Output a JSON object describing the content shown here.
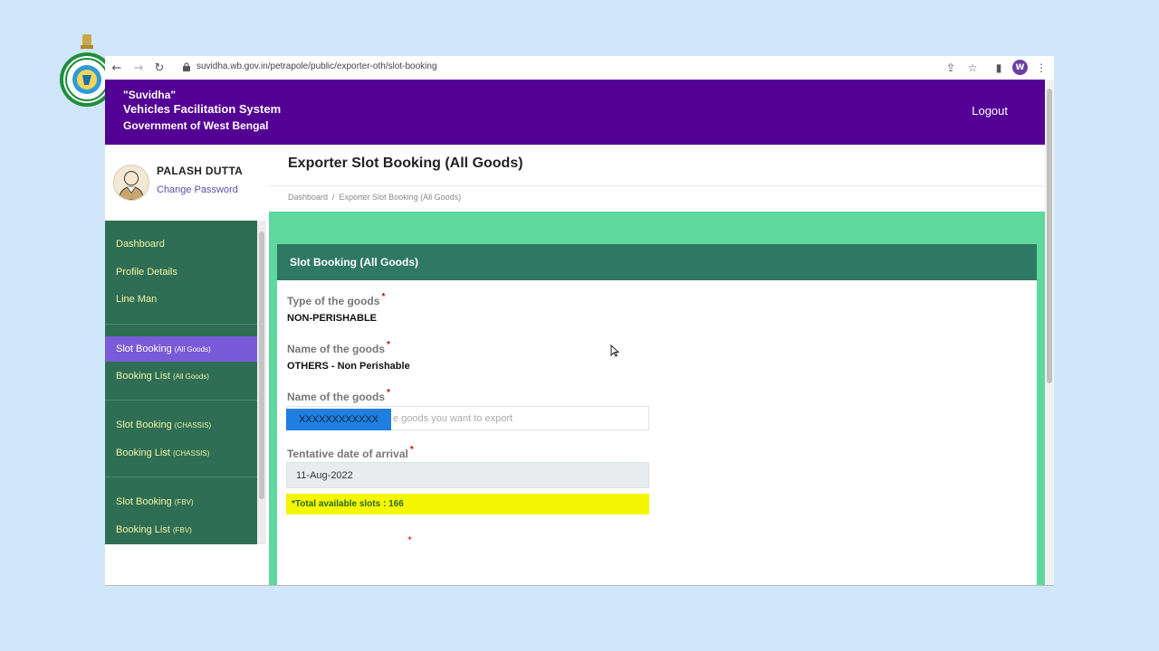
{
  "browser": {
    "url": "suvidha.wb.gov.in/petrapole/public/exporter-oth/slot-booking",
    "profile_initial": "W"
  },
  "header": {
    "title_line1": "\"Suvidha\"",
    "title_line2": "Vehicles Facilitation System",
    "title_line3": "Government of West Bengal",
    "logout_label": "Logout"
  },
  "user": {
    "name": "PALASH DUTTA",
    "change_password_label": "Change Password"
  },
  "sidebar": {
    "items": [
      {
        "label": "Dashboard",
        "tag": ""
      },
      {
        "label": "Profile Details",
        "tag": ""
      },
      {
        "label": "Line Man",
        "tag": ""
      },
      {
        "label": "Slot Booking",
        "tag": "(All Goods)"
      },
      {
        "label": "Booking List",
        "tag": "(All Goods)"
      },
      {
        "label": "Slot Booking",
        "tag": "(CHASSIS)"
      },
      {
        "label": "Booking List",
        "tag": "(CHASSIS)"
      },
      {
        "label": "Slot Booking",
        "tag": "(FBV)"
      },
      {
        "label": "Booking List",
        "tag": "(FBV)"
      }
    ],
    "active_index": 3
  },
  "page": {
    "title": "Exporter Slot Booking (All Goods)",
    "breadcrumb": [
      "Dashboard",
      "Exporter Slot Booking (All Goods)"
    ],
    "breadcrumb_separator": "/"
  },
  "form": {
    "header": "Slot Booking (All Goods)",
    "required_mark": "*",
    "type_label": "Type of the goods",
    "type_value": "NON-PERISHABLE",
    "name_label": "Name of the goods",
    "name_value": "OTHERS - Non Perishable",
    "goods_input_label": "Name of the goods",
    "goods_input_placeholder": "e goods you want to export",
    "goods_input_redacted": "XXXXXXXXXXXX",
    "arrival_label": "Tentative date of arrival",
    "arrival_value": "11-Aug-2022",
    "slots_text": "*Total available slots : 166"
  },
  "colors": {
    "header_purple": "#530094",
    "sidebar_green": "#2f6e54",
    "panel_green": "#5fd89e",
    "card_header_green": "#2f7864",
    "active_purple": "#7a5ad6",
    "slots_yellow": "#f4f700"
  }
}
